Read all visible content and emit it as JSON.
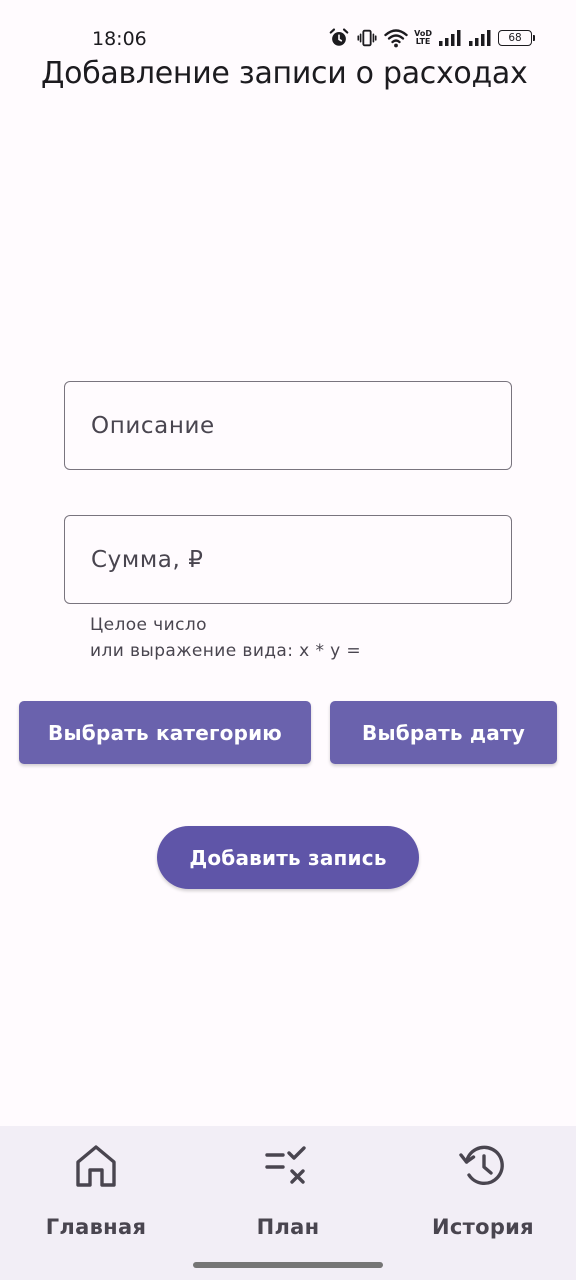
{
  "status_bar": {
    "time": "18:06",
    "battery_level": "68",
    "volte_top": "VoD",
    "volte_bottom": "LTE",
    "icons": [
      "alarm-icon",
      "vibrate-icon",
      "wifi-icon",
      "volte-icon",
      "signal-icon",
      "signal-icon",
      "battery-icon"
    ]
  },
  "header": {
    "title": "Добавление записи о расходах"
  },
  "form": {
    "description_placeholder": "Описание",
    "amount_placeholder": "Сумма, ₽",
    "amount_helper_line1": "Целое число",
    "amount_helper_line2": "или выражение вида: x * y ="
  },
  "buttons": {
    "select_category": "Выбрать категорию",
    "select_date": "Выбрать дату",
    "add_record": "Добавить запись"
  },
  "bottom_nav": {
    "items": [
      {
        "label": "Главная",
        "icon": "home-icon"
      },
      {
        "label": "План",
        "icon": "checklist-icon"
      },
      {
        "label": "История",
        "icon": "history-icon"
      }
    ]
  },
  "colors": {
    "background": "#fffbfe",
    "primary_button": "#6a62ad",
    "nav_background": "#f2eef6",
    "outline": "#79747e",
    "on_surface_variant": "#49454f"
  }
}
